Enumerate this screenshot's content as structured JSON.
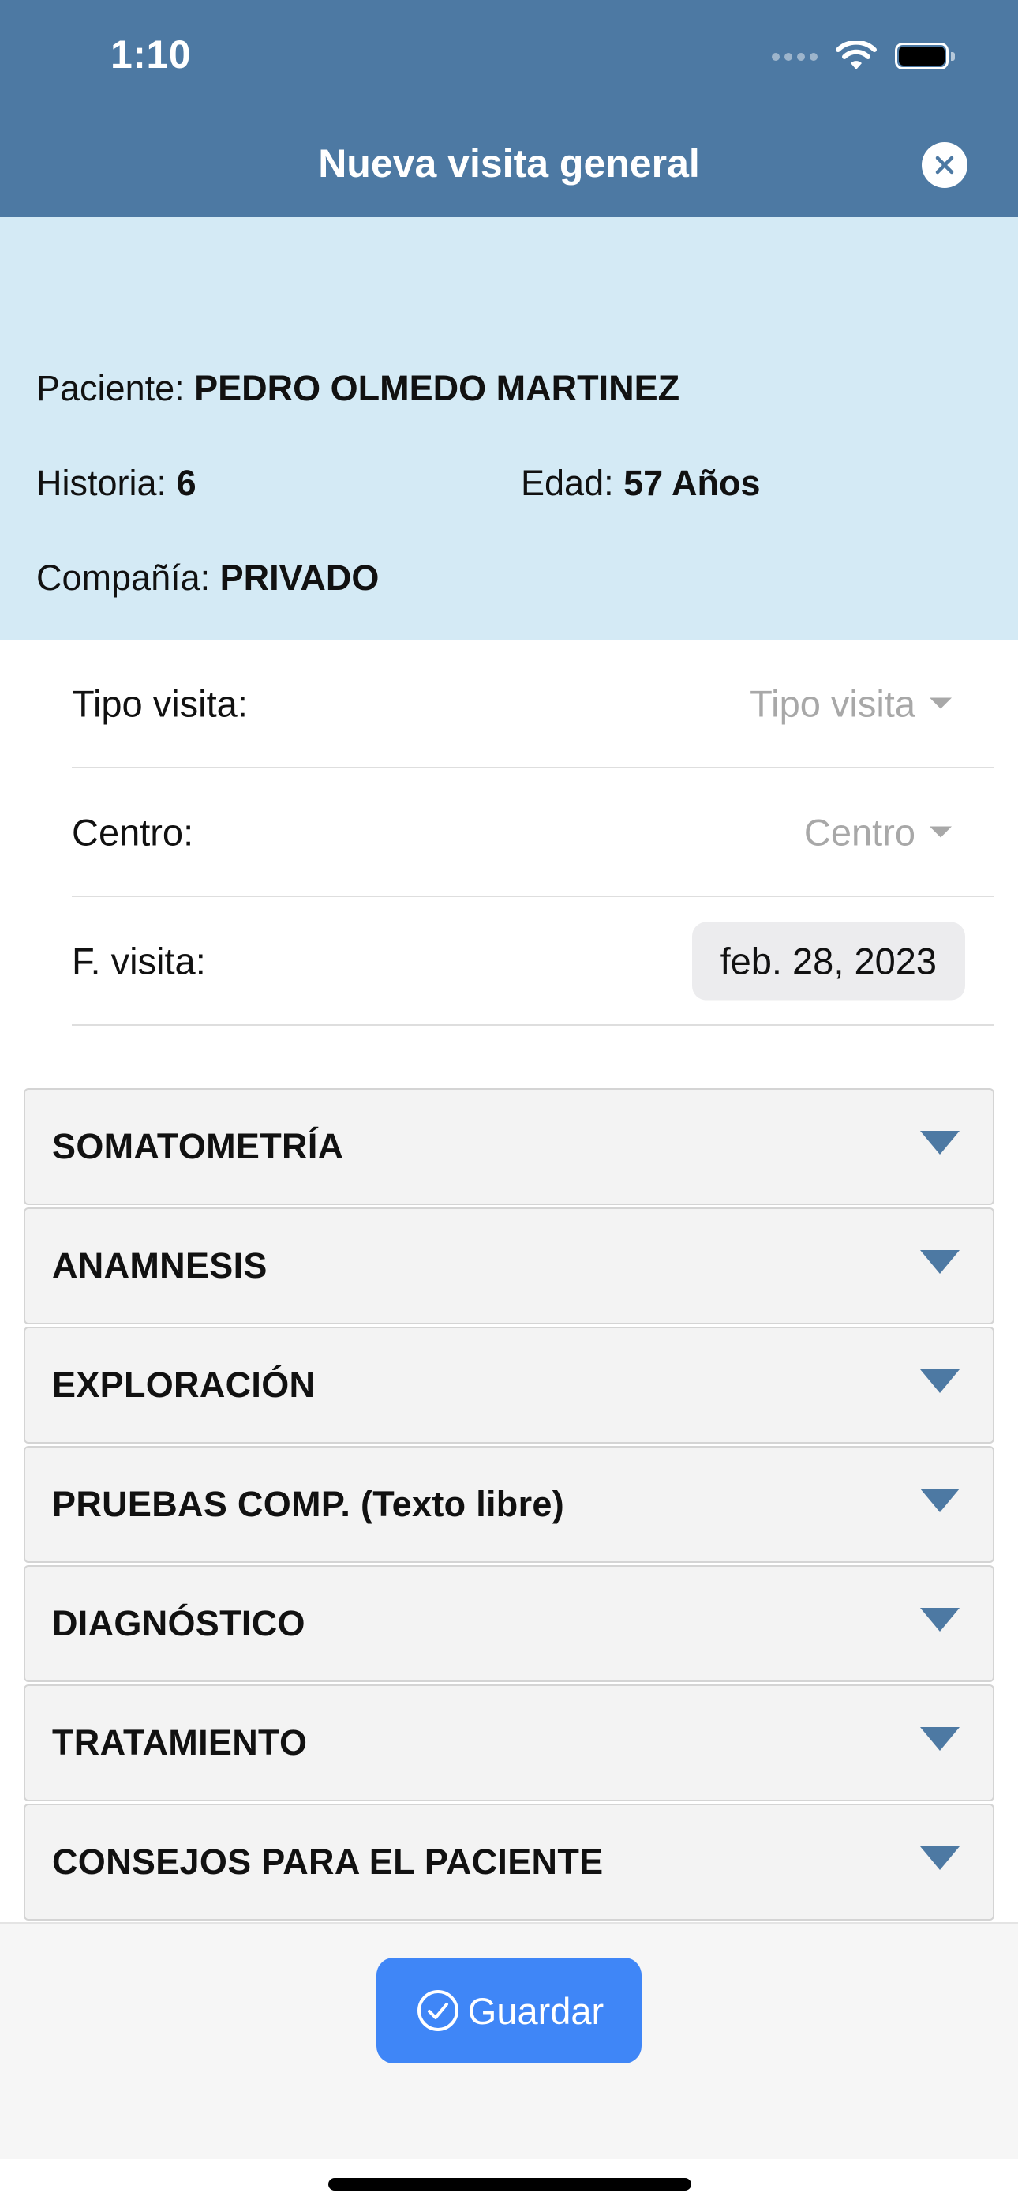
{
  "status_bar": {
    "time": "1:10"
  },
  "header": {
    "title": "Nueva visita general",
    "close_icon": "close-icon"
  },
  "patient": {
    "paciente_label": "Paciente:",
    "paciente_value": "PEDRO OLMEDO MARTINEZ",
    "historia_label": "Historia:",
    "historia_value": "6",
    "edad_label": "Edad:",
    "edad_value": "57 Años",
    "compania_label": "Compañía:",
    "compania_value": "PRIVADO"
  },
  "form": {
    "tipo_visita": {
      "label": "Tipo visita:",
      "placeholder": "Tipo visita"
    },
    "centro": {
      "label": "Centro:",
      "placeholder": "Centro"
    },
    "fecha": {
      "label": "F. visita:",
      "value": "feb. 28, 2023"
    }
  },
  "sections": [
    {
      "label": "SOMATOMETRÍA"
    },
    {
      "label": "ANAMNESIS"
    },
    {
      "label": "EXPLORACIÓN"
    },
    {
      "label": "PRUEBAS COMP. (Texto libre)"
    },
    {
      "label": "DIAGNÓSTICO"
    },
    {
      "label": "TRATAMIENTO"
    },
    {
      "label": "CONSEJOS PARA EL PACIENTE"
    }
  ],
  "footer": {
    "save_label": "Guardar",
    "save_icon": "check-circle-icon"
  },
  "colors": {
    "header_bg": "#4d79a3",
    "patient_bg": "#d4eaf5",
    "accent_caret": "#4d79a3",
    "save_button": "#3f86f7"
  }
}
